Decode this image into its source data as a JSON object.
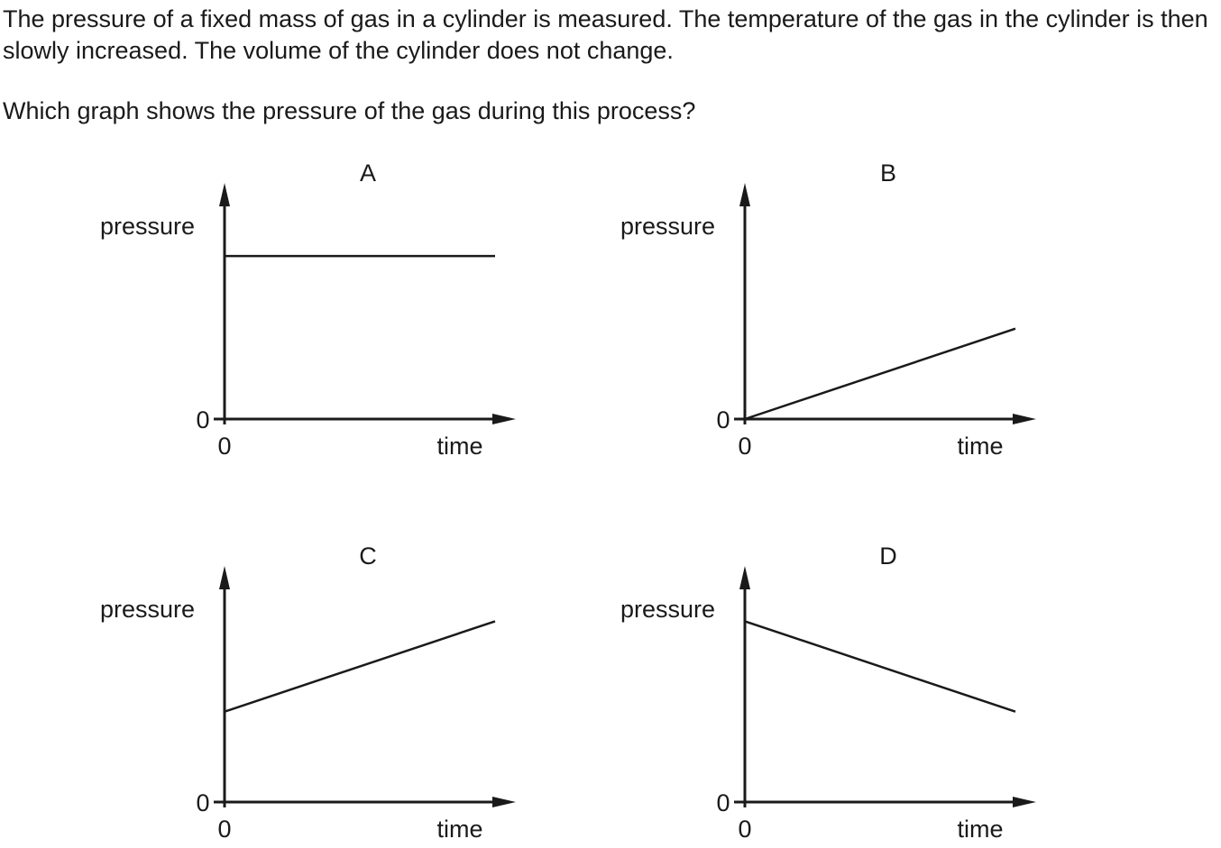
{
  "question": {
    "stem": "The pressure of a fixed mass of gas in a cylinder is measured. The temperature of the gas in the cylinder is then slowly increased. The volume of the cylinder does not change.",
    "prompt": "Which graph shows the pressure of the gas during this process?"
  },
  "chart_data": [
    {
      "type": "line",
      "title": "A",
      "xlabel": "time",
      "ylabel": "pressure",
      "x_tick_labels": [
        "0"
      ],
      "y_tick_labels": [
        "0"
      ],
      "xlim": [
        0,
        10
      ],
      "ylim": [
        0,
        10
      ],
      "series": [
        {
          "x": [
            0,
            10
          ],
          "y": [
            8.3,
            8.3
          ]
        }
      ]
    },
    {
      "type": "line",
      "title": "B",
      "xlabel": "time",
      "ylabel": "pressure",
      "x_tick_labels": [
        "0"
      ],
      "y_tick_labels": [
        "0"
      ],
      "xlim": [
        0,
        10
      ],
      "ylim": [
        0,
        10
      ],
      "series": [
        {
          "x": [
            0,
            10
          ],
          "y": [
            0,
            4.6
          ]
        }
      ]
    },
    {
      "type": "line",
      "title": "C",
      "xlabel": "time",
      "ylabel": "pressure",
      "x_tick_labels": [
        "0"
      ],
      "y_tick_labels": [
        "0"
      ],
      "xlim": [
        0,
        10
      ],
      "ylim": [
        0,
        10
      ],
      "series": [
        {
          "x": [
            0,
            10
          ],
          "y": [
            4.6,
            9.2
          ]
        }
      ]
    },
    {
      "type": "line",
      "title": "D",
      "xlabel": "time",
      "ylabel": "pressure",
      "x_tick_labels": [
        "0"
      ],
      "y_tick_labels": [
        "0"
      ],
      "xlim": [
        0,
        10
      ],
      "ylim": [
        0,
        10
      ],
      "series": [
        {
          "x": [
            0,
            10
          ],
          "y": [
            9.2,
            4.6
          ]
        }
      ]
    }
  ]
}
